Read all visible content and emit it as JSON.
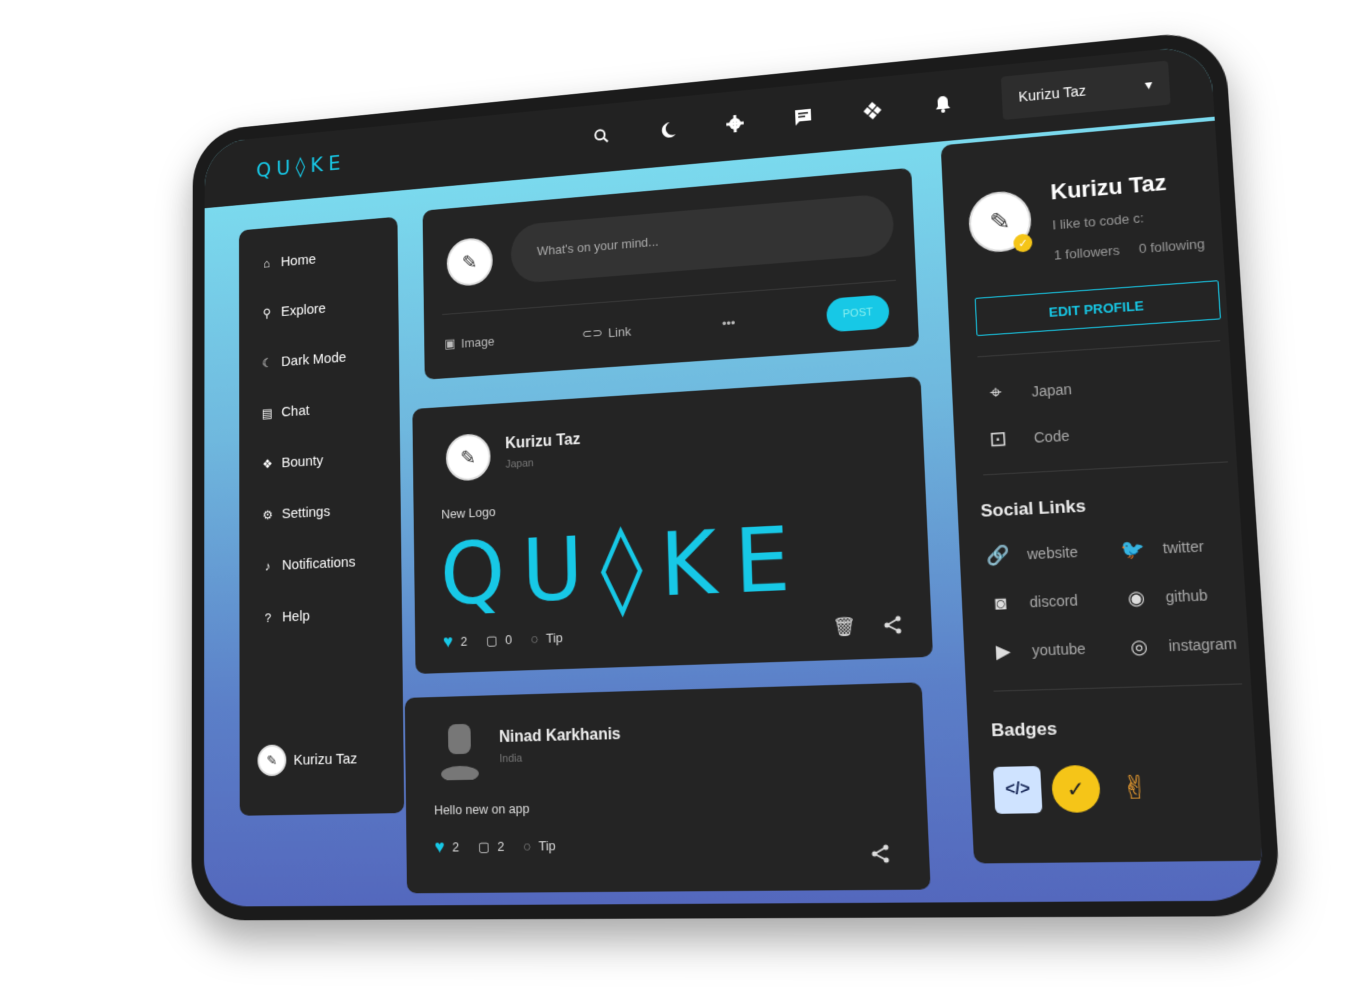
{
  "topbar": {
    "logo": "QU◊KE",
    "icons": [
      "search-icon",
      "moon-icon",
      "gear-icon",
      "chat-icon",
      "bounty-icon",
      "bell-icon",
      "help-icon"
    ],
    "user_menu": "Kurizu Taz"
  },
  "sidebar": {
    "items": [
      {
        "label": "Home",
        "icon": "home-icon"
      },
      {
        "label": "Explore",
        "icon": "search-icon"
      },
      {
        "label": "Dark Mode",
        "icon": "moon-icon"
      },
      {
        "label": "Chat",
        "icon": "chat-icon"
      },
      {
        "label": "Bounty",
        "icon": "bounty-icon"
      },
      {
        "label": "Settings",
        "icon": "gear-icon"
      },
      {
        "label": "Notifications",
        "icon": "bell-icon"
      },
      {
        "label": "Help",
        "icon": "help-icon"
      }
    ],
    "user": "Kurizu Taz"
  },
  "composer": {
    "placeholder": "What's on your mind...",
    "image_label": "Image",
    "link_label": "Link",
    "more": "•••",
    "post_label": "POST"
  },
  "posts": [
    {
      "author": "Kurizu Taz",
      "location": "Japan",
      "text": "New Logo",
      "image_text": "QU◊KE",
      "likes": "2",
      "comments": "0",
      "tip": "Tip"
    },
    {
      "author": "Ninad Karkhanis",
      "location": "India",
      "text": "Hello new on app",
      "likes": "2",
      "comments": "2",
      "tip": "Tip"
    }
  ],
  "profile": {
    "name": "Kurizu Taz",
    "bio": "I like to code c:",
    "followers": "1 followers",
    "following": "0 following",
    "edit_label": "EDIT PROFILE",
    "location": "Japan",
    "work": "Code",
    "social_title": "Social Links",
    "social": [
      {
        "label": "website",
        "icon": "link-icon"
      },
      {
        "label": "twitter",
        "icon": "twitter-icon"
      },
      {
        "label": "discord",
        "icon": "discord-icon"
      },
      {
        "label": "github",
        "icon": "github-icon"
      },
      {
        "label": "youtube",
        "icon": "youtube-icon"
      },
      {
        "label": "instagram",
        "icon": "instagram-icon"
      }
    ],
    "badges_title": "Badges",
    "badges": [
      "code-badge-icon",
      "verified-badge-icon",
      "peace-hand-badge-icon"
    ]
  },
  "colors": {
    "accent": "#17c8e6",
    "panel": "#242424",
    "topbar": "#222222"
  }
}
